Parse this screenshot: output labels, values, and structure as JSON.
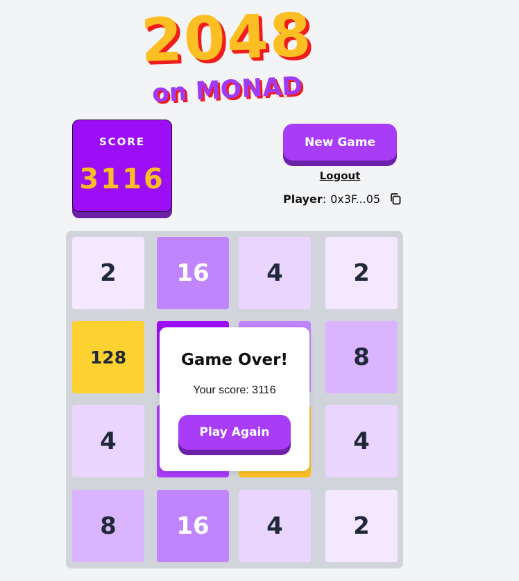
{
  "logo": {
    "title": "2048",
    "subtitle": "on MONAD"
  },
  "score": {
    "label": "SCORE",
    "value": "3116"
  },
  "controls": {
    "new_game_label": "New Game",
    "logout_label": "Logout"
  },
  "player": {
    "label": "Player",
    "separator": ":",
    "address": "0x3F...05",
    "copy_icon": "copy-icon"
  },
  "colors": {
    "board": "#d1d5db",
    "accent": "#a83cf7",
    "score_bg": "#9c0ef5",
    "score_value": "#fbbf24"
  },
  "board": {
    "rows": [
      [
        {
          "value": "2",
          "bg": "#f3e8ff"
        },
        {
          "value": "16",
          "bg": "#c084fc"
        },
        {
          "value": "4",
          "bg": "#ead5ff"
        },
        {
          "value": "2",
          "bg": "#f3e8ff"
        }
      ],
      [
        {
          "value": "128",
          "bg": "#fdd12f"
        },
        {
          "value": "",
          "bg": "#9c0ef5"
        },
        {
          "value": "",
          "bg": "#c084fc"
        },
        {
          "value": "8",
          "bg": "#dab4fe"
        }
      ],
      [
        {
          "value": "4",
          "bg": "#ead5ff"
        },
        {
          "value": "",
          "bg": "#a83cf7"
        },
        {
          "value": "",
          "bg": "#fbbf24"
        },
        {
          "value": "4",
          "bg": "#ead5ff"
        }
      ],
      [
        {
          "value": "8",
          "bg": "#dab4fe"
        },
        {
          "value": "16",
          "bg": "#c084fc"
        },
        {
          "value": "4",
          "bg": "#ead5ff"
        },
        {
          "value": "2",
          "bg": "#f3e8ff"
        }
      ]
    ]
  },
  "modal": {
    "title": "Game Over!",
    "score_text": "Your score: 3116",
    "button_label": "Play Again"
  }
}
